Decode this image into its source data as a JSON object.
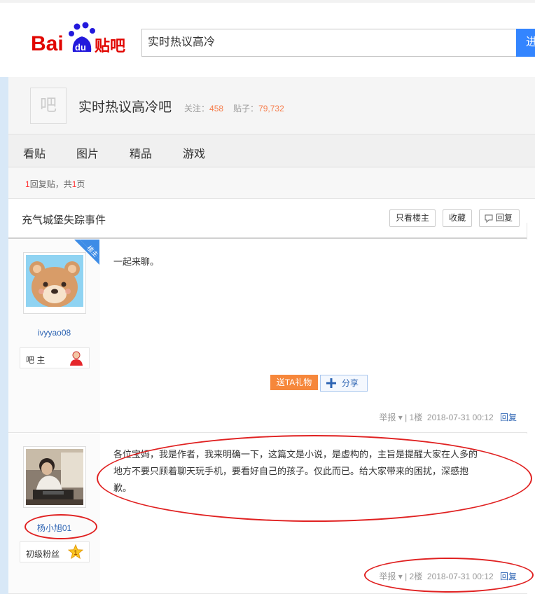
{
  "header": {
    "logo_text": "Bai",
    "logo_du": "du",
    "logo_tieba": "贴吧",
    "search_value": "实时热议高冷",
    "search_button_label": "进"
  },
  "forum": {
    "avatar_char": "吧",
    "name": "实时热议高冷吧",
    "follow_label": "关注：",
    "follow_count": "458",
    "posts_label": "贴子：",
    "posts_count": "79,732"
  },
  "nav": {
    "tabs": [
      {
        "label": "看贴"
      },
      {
        "label": "图片"
      },
      {
        "label": "精品"
      },
      {
        "label": "游戏"
      }
    ]
  },
  "pagination": {
    "reply_count": "1",
    "reply_text": "回复贴，共",
    "page_count": "1",
    "page_suffix": "页"
  },
  "thread": {
    "title": "充气城堡失踪事件",
    "only_op_label": "只看楼主",
    "favorite_label": "收藏",
    "reply_label": "回复"
  },
  "posts": [
    {
      "author": "ivyyao08",
      "badge": "吧 主",
      "corner_tag": "楼主",
      "content": "一起来聊。",
      "gift_label": "送TA礼物",
      "share_label": "分享",
      "report": "举报",
      "floor": "1楼",
      "time": "2018-07-31 00:12",
      "reply": "回复"
    },
    {
      "author": "杨小旭01",
      "badge": "初级粉丝",
      "level": "1",
      "content_line1": "各位宝妈，我是作者，我来明确一下，这篇文是小说，是虚构的，主旨是提醒大家在人多的",
      "content_line2": "地方不要只顾着聊天玩手机，要看好自己的孩子。仅此而已。给大家带来的困扰，深感抱",
      "content_line3": "歉。",
      "report": "举报",
      "floor": "2楼",
      "time": "2018-07-31 00:12",
      "reply": "回复"
    }
  ],
  "colors": {
    "accent_blue": "#3385ff",
    "link_blue": "#2d64b3",
    "orange": "#f67d4b",
    "annotation_red": "#e02121"
  }
}
